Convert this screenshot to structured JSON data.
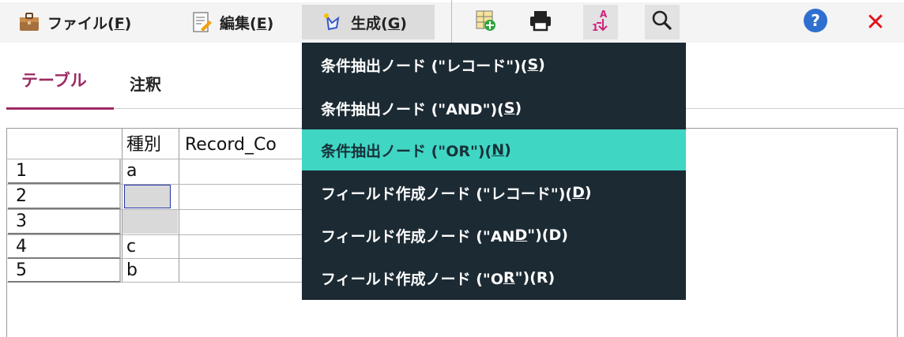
{
  "menubar": {
    "file": {
      "label": "ファイル(",
      "key": "F",
      "suffix": ")"
    },
    "edit": {
      "label": "編集(",
      "key": "E",
      "suffix": ")"
    },
    "generate": {
      "label": "生成(",
      "key": "G",
      "suffix": ")"
    }
  },
  "toolbar": {
    "icons": [
      "add-table-icon",
      "print-icon",
      "sort-icon",
      "search-icon",
      "help-icon",
      "close-icon"
    ],
    "sort_letter_top": "A",
    "sort_letter_bottom": "1",
    "help_glyph": "?",
    "close_glyph": "✕"
  },
  "tabs": [
    {
      "label": "テーブル"
    },
    {
      "label": "注釈"
    }
  ],
  "grid": {
    "columns": [
      "",
      "種別",
      "Record_Co"
    ],
    "rows": [
      {
        "num": "1",
        "type": "a"
      },
      {
        "num": "2",
        "type": ""
      },
      {
        "num": "3",
        "type": ""
      },
      {
        "num": "4",
        "type": "c"
      },
      {
        "num": "5",
        "type": "b"
      }
    ]
  },
  "dropdown": {
    "items": [
      {
        "pre": "条件抽出ノード (\"レコード\")(",
        "u": "S",
        "post": ")"
      },
      {
        "pre": "条件抽出ノード (\"AND\")(",
        "u": "S",
        "post": ")"
      },
      {
        "pre": "条件抽出ノード (\"OR\")(",
        "u": "N",
        "post": ")"
      },
      {
        "pre": "フィールド作成ノード (\"レコード\")(",
        "u": "D",
        "post": ")"
      },
      {
        "pre": "フィールド作成ノード (\"AN",
        "u": "D",
        "post": "\")(D)"
      },
      {
        "pre": "フィールド作成ノード (\"O",
        "u": "R",
        "post": "\")(R)"
      }
    ],
    "highlighted_index": 2
  },
  "colors": {
    "accent": "#9c2a63",
    "menu_bg": "#1c2a33",
    "highlight": "#40d6c4",
    "close_red": "#e0151b",
    "help_blue": "#2f6fd0"
  }
}
